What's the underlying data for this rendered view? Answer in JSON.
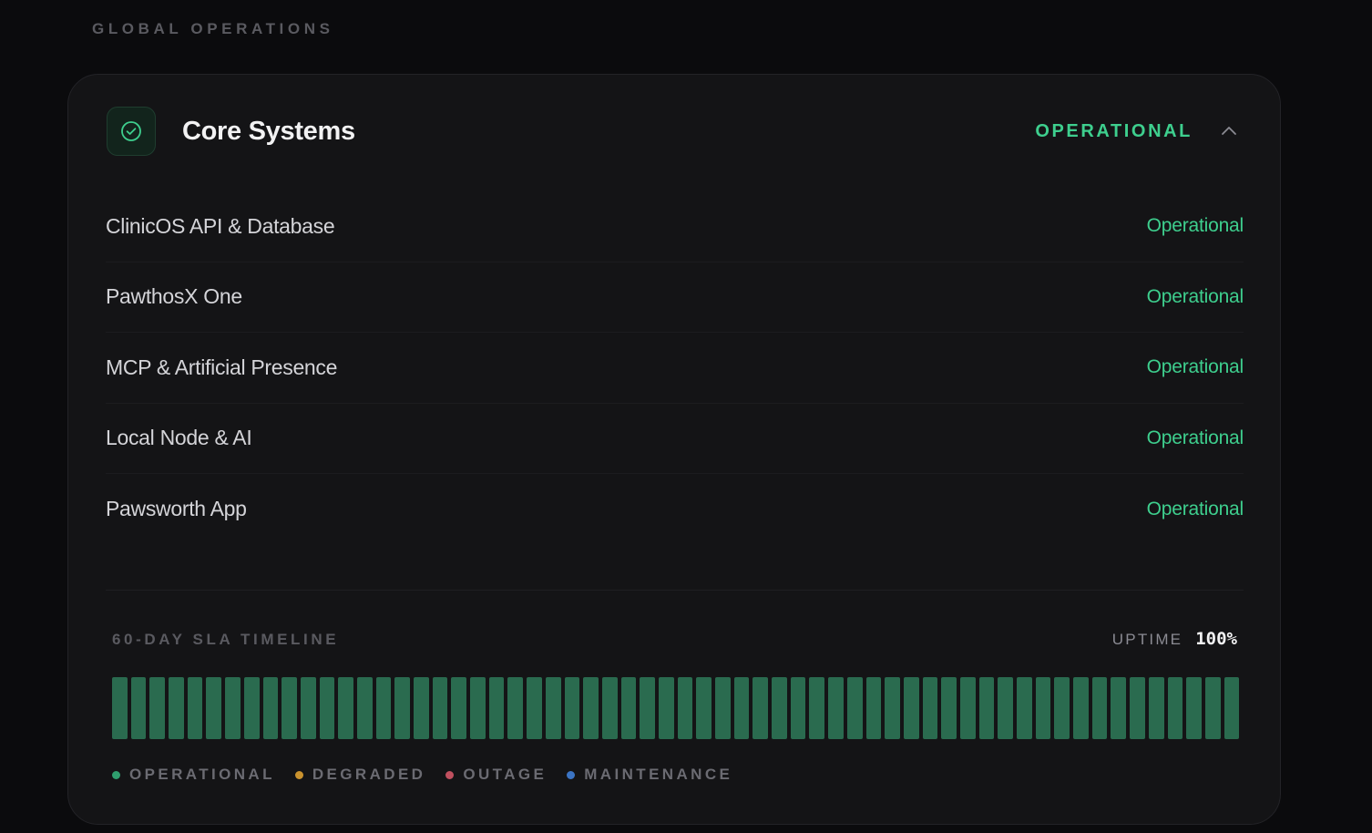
{
  "page": {
    "section_title": "GLOBAL OPERATIONS"
  },
  "group": {
    "title": "Core Systems",
    "status": "OPERATIONAL",
    "icon": "check-circle-icon",
    "expanded": true
  },
  "services": [
    {
      "name": "ClinicOS API & Database",
      "status": "Operational"
    },
    {
      "name": "PawthosX One",
      "status": "Operational"
    },
    {
      "name": "MCP & Artificial Presence",
      "status": "Operational"
    },
    {
      "name": "Local Node & AI",
      "status": "Operational"
    },
    {
      "name": "Pawsworth App",
      "status": "Operational"
    }
  ],
  "sla": {
    "label": "60-DAY SLA TIMELINE",
    "uptime_label": "UPTIME",
    "uptime_value": "100%",
    "days": 60,
    "day_status": "operational"
  },
  "legend": [
    {
      "label": "OPERATIONAL",
      "color": "#2f9e6e"
    },
    {
      "label": "DEGRADED",
      "color": "#c9922e"
    },
    {
      "label": "OUTAGE",
      "color": "#c0505f"
    },
    {
      "label": "MAINTENANCE",
      "color": "#3b74c4"
    }
  ],
  "colors": {
    "accent": "#3ecf8e",
    "bar_operational": "#2a6b4f"
  }
}
